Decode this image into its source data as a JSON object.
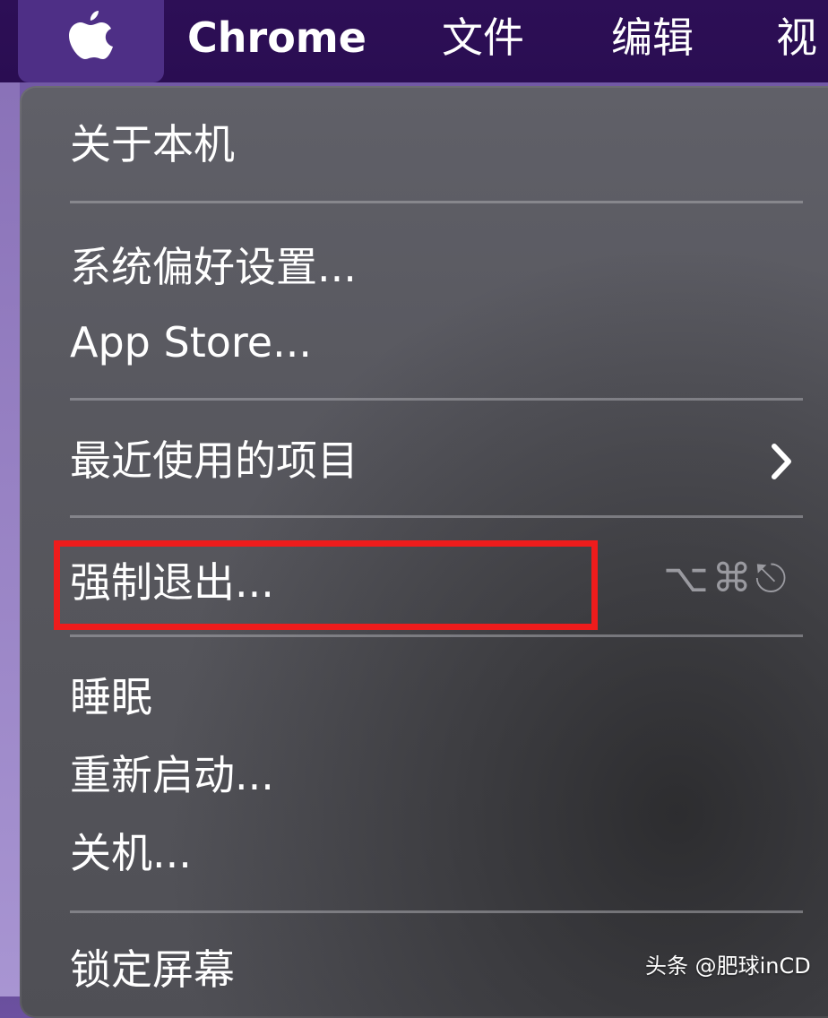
{
  "menubar": {
    "app_name": "Chrome",
    "items": [
      "文件",
      "编辑",
      "视"
    ]
  },
  "apple_menu": {
    "items": [
      {
        "label": "关于本机"
      },
      {
        "label": "系统偏好设置..."
      },
      {
        "label": "App Store..."
      },
      {
        "label": "最近使用的项目"
      },
      {
        "label": "强制退出...",
        "shortcut": "⌥⌘⎋"
      },
      {
        "label": "睡眠"
      },
      {
        "label": "重新启动..."
      },
      {
        "label": "关机..."
      },
      {
        "label": "锁定屏幕"
      }
    ]
  },
  "watermark": "头条 @肥球inCD",
  "colors": {
    "menubar": "#2d0f56",
    "apple_button": "#4e2f86",
    "menu_background": "#58585f",
    "highlight": "#ee1c1c"
  }
}
